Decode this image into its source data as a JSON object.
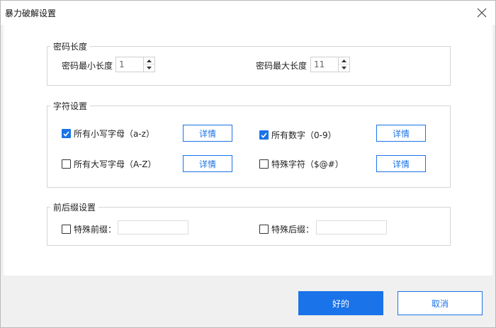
{
  "window": {
    "title": "暴力破解设置",
    "close_icon": "close-icon"
  },
  "password_length": {
    "legend": "密码长度",
    "min_label": "密码最小长度",
    "min_value": "1",
    "max_label": "密码最大长度",
    "max_value": "11"
  },
  "charset": {
    "legend": "字符设置",
    "items": [
      {
        "label": "所有小写字母（a-z）",
        "checked": true,
        "detail_label": "详情"
      },
      {
        "label": "所有数字（0-9）",
        "checked": true,
        "detail_label": "详情"
      },
      {
        "label": "所有大写字母（A-Z）",
        "checked": false,
        "detail_label": "详情"
      },
      {
        "label": "特殊字符（$@#）",
        "checked": false,
        "detail_label": "详情"
      }
    ]
  },
  "affix": {
    "legend": "前后缀设置",
    "prefix_label": "特殊前缀：",
    "prefix_value": "",
    "suffix_label": "特殊后缀：",
    "suffix_value": ""
  },
  "footer": {
    "ok_label": "好的",
    "cancel_label": "取消"
  },
  "colors": {
    "accent": "#1a73e8",
    "dialog_bg": "#f0f0f0",
    "panel_bg": "#ffffff"
  }
}
